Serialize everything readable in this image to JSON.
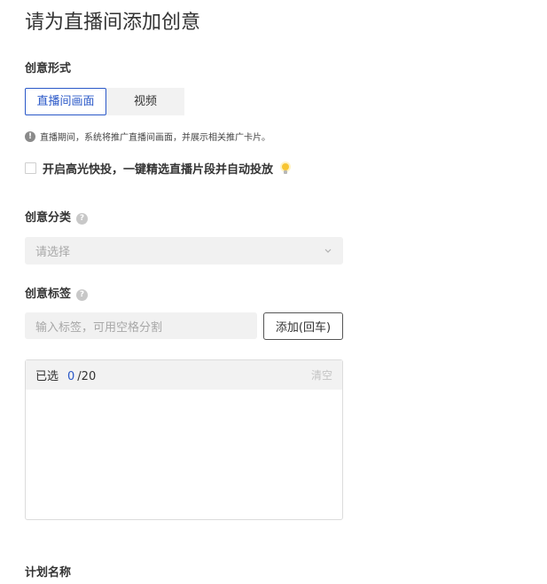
{
  "page": {
    "title": "请为直播间添加创意"
  },
  "creative_form": {
    "label": "创意形式",
    "tabs": [
      {
        "label": "直播间画面",
        "active": true
      },
      {
        "label": "视频",
        "active": false
      }
    ],
    "info_text": "直播期间，系统将推广直播间画面，并展示相关推广卡片。"
  },
  "highlight_option": {
    "label": "开启高光快投，一键精选直播片段并自动投放",
    "checked": false
  },
  "creative_category": {
    "label": "创意分类",
    "placeholder": "请选择"
  },
  "creative_tags": {
    "label": "创意标签",
    "input_placeholder": "输入标签，可用空格分割",
    "add_button": "添加(回车)",
    "selected_label": "已选",
    "selected_count": "0",
    "selected_max": "/20",
    "clear_label": "清空"
  },
  "plan_name": {
    "label": "计划名称"
  },
  "colors": {
    "accent": "#2a58c8",
    "muted": "#a8a8a8",
    "field_bg": "#f1f1f1"
  },
  "icons": [
    "info-icon",
    "help-icon",
    "bulb-icon",
    "chevron-down-icon"
  ]
}
